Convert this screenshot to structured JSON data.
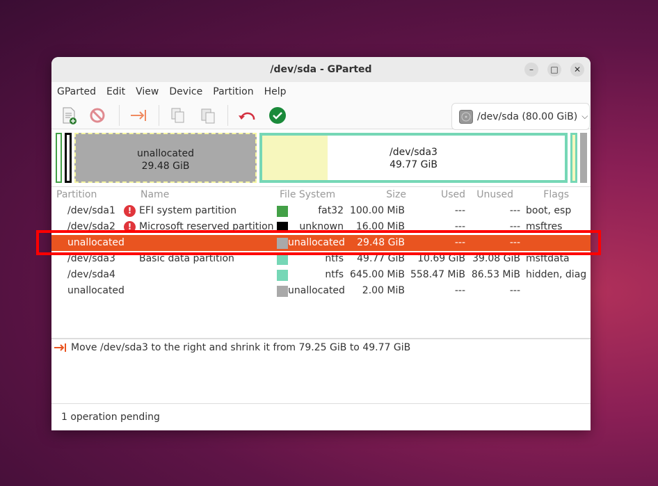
{
  "window": {
    "title": "/dev/sda - GParted",
    "minimize": "–",
    "maximize": "□",
    "close": "✕"
  },
  "menu": [
    "GParted",
    "Edit",
    "View",
    "Device",
    "Partition",
    "Help"
  ],
  "toolbar": {
    "icons": [
      "new-icon",
      "delete-icon",
      "resize-move-icon",
      "copy-icon",
      "paste-icon",
      "undo-icon",
      "apply-icon"
    ]
  },
  "device_selector": {
    "value": "/dev/sda (80.00 GiB)"
  },
  "diskmap": {
    "unallocated": {
      "label": "unallocated",
      "size": "29.48 GiB"
    },
    "sda3": {
      "label": "/dev/sda3",
      "size": "49.77 GiB",
      "used_fraction": 0.215
    }
  },
  "table": {
    "headers": [
      "Partition",
      "Name",
      "File System",
      "Size",
      "Used",
      "Unused",
      "Flags"
    ],
    "rows": [
      {
        "partition": "/dev/sda1",
        "warn": true,
        "name": "EFI system partition",
        "color": "#43a047",
        "fs": "fat32",
        "size": "100.00 MiB",
        "used": "---",
        "unused": "---",
        "flags": "boot, esp"
      },
      {
        "partition": "/dev/sda2",
        "warn": true,
        "name": "Microsoft reserved partition",
        "color": "#000000",
        "fs": "unknown",
        "size": "16.00 MiB",
        "used": "---",
        "unused": "---",
        "flags": "msftres"
      },
      {
        "partition": "unallocated",
        "warn": false,
        "name": "",
        "color": "#a9a9a9",
        "fs": "unallocated",
        "size": "29.48 GiB",
        "used": "---",
        "unused": "---",
        "flags": "",
        "selected": true
      },
      {
        "partition": "/dev/sda3",
        "warn": false,
        "name": "Basic data partition",
        "color": "#76d7b6",
        "fs": "ntfs",
        "size": "49.77 GiB",
        "used": "10.69 GiB",
        "unused": "39.08 GiB",
        "flags": "msftdata"
      },
      {
        "partition": "/dev/sda4",
        "warn": false,
        "name": "",
        "color": "#76d7b6",
        "fs": "ntfs",
        "size": "645.00 MiB",
        "used": "558.47 MiB",
        "unused": "86.53 MiB",
        "flags": "hidden, diag"
      },
      {
        "partition": "unallocated",
        "warn": false,
        "name": "",
        "color": "#a9a9a9",
        "fs": "unallocated",
        "size": "2.00 MiB",
        "used": "---",
        "unused": "---",
        "flags": ""
      }
    ]
  },
  "operations": [
    "Move /dev/sda3 to the right and shrink it from 79.25 GiB to 49.77 GiB"
  ],
  "status": "1 operation pending",
  "colors": {
    "selection": "#e95420",
    "highlight_box": "#ff0000"
  }
}
